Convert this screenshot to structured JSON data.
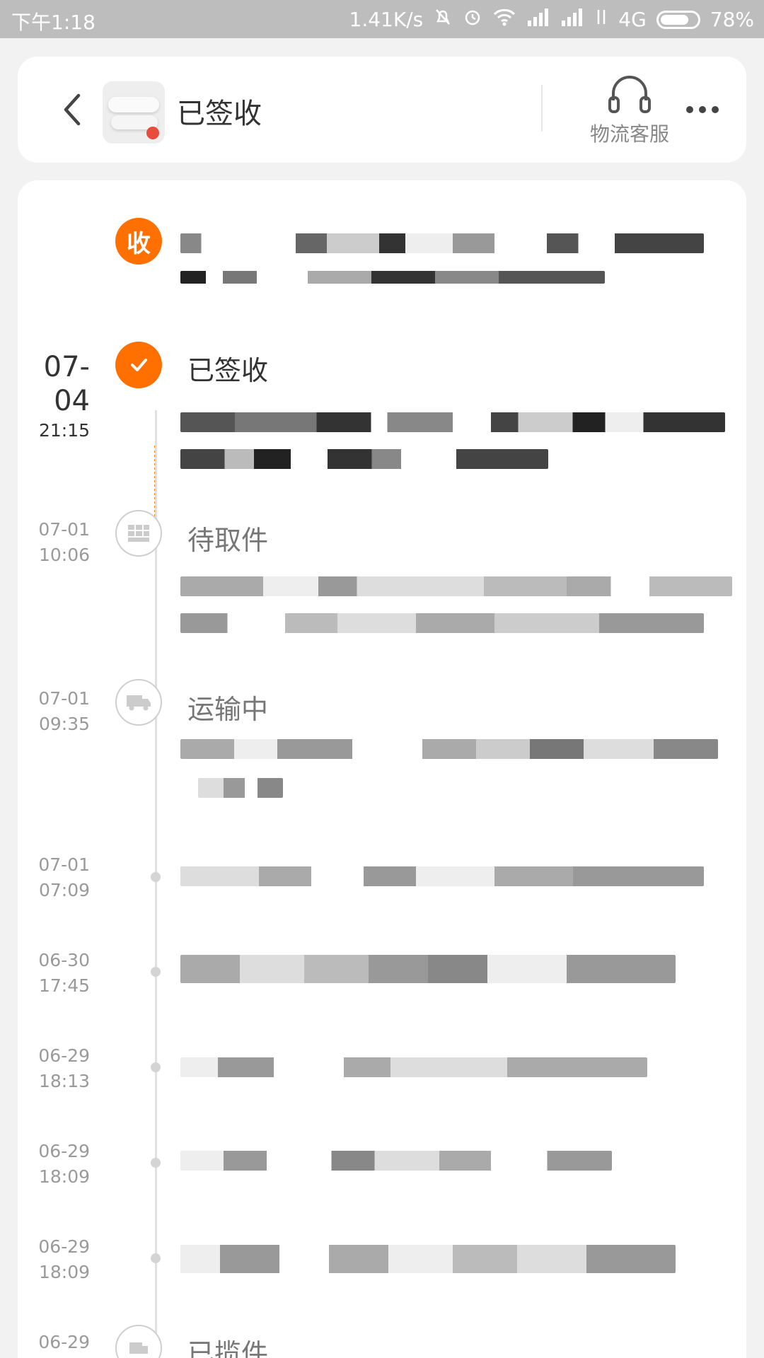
{
  "status_bar": {
    "time": "下午1:18",
    "speed": "1.41K/s",
    "network": "4G",
    "battery": "78%",
    "battery_level": 0.78
  },
  "header": {
    "title": "已签收",
    "service_label": "物流客服"
  },
  "timeline": {
    "receiver_label": "收",
    "events": [
      {
        "date": "07-04",
        "time": "21:15",
        "title": "已签收"
      },
      {
        "date": "07-01",
        "time": "10:06",
        "title": "待取件"
      },
      {
        "date": "07-01",
        "time": "09:35",
        "title": "运输中"
      },
      {
        "date": "07-01",
        "time": "07:09"
      },
      {
        "date": "06-30",
        "time": "17:45"
      },
      {
        "date": "06-29",
        "time": "18:13"
      },
      {
        "date": "06-29",
        "time": "18:09"
      },
      {
        "date": "06-29",
        "time": "18:09"
      },
      {
        "date": "06-29",
        "title": "已揽件"
      }
    ]
  },
  "colors": {
    "accent": "#ff7000",
    "status_bar_bg": "#bdbdbd",
    "page_bg": "#f2f2f2"
  }
}
